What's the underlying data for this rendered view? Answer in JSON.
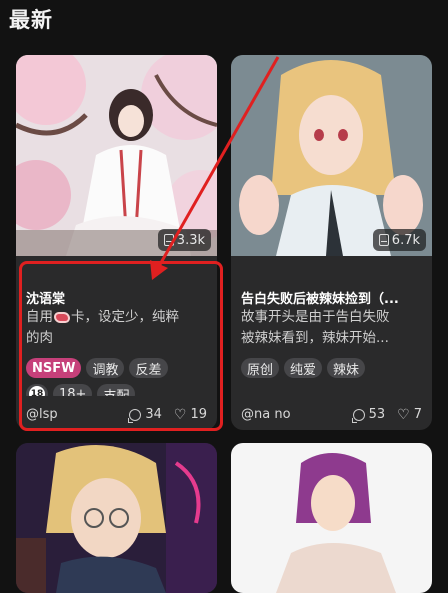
{
  "section": {
    "title": "最新"
  },
  "cards": [
    {
      "views": "3.3k",
      "title": "沈语棠",
      "desc_line1_prefix": "自用",
      "desc_line1_suffix": "卡，设定少，纯粹",
      "desc_line2": "的肉",
      "tags": [
        "NSFW",
        "调教",
        "反差"
      ],
      "tags_row2": [
        "18+",
        "支配"
      ],
      "author": "@lsp",
      "comments": "34",
      "likes": "19"
    },
    {
      "views": "6.7k",
      "title": "告白失败后被辣妹捡到（...",
      "desc_line1": "故事开头是由于告白失败",
      "desc_line2": "被辣妹看到，辣妹开始...",
      "tags": [
        "原创",
        "纯爱",
        "辣妹"
      ],
      "author": "@na no",
      "comments": "53",
      "likes": "7"
    }
  ],
  "colors": {
    "background": "#121212",
    "card": "#2a2a2b",
    "nsfw_tag": "#c6407a",
    "annotation_red": "#e02020"
  },
  "icons": [
    "book-icon",
    "chat-icon",
    "heart-icon",
    "meat-emoji-icon",
    "age-18-icon"
  ]
}
